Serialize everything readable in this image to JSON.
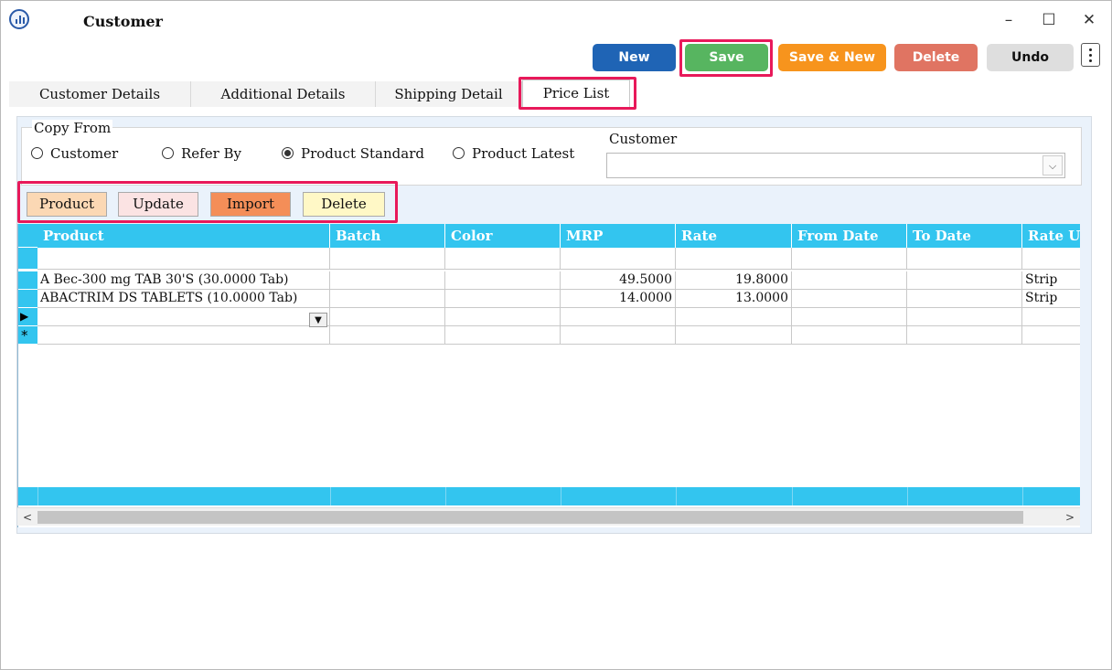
{
  "window": {
    "title": "Customer",
    "controls": {
      "minimize": "–",
      "maximize": "☐",
      "close": "✕"
    }
  },
  "toolbar": {
    "new_label": "New",
    "save_label": "Save",
    "save_new_label": "Save & New",
    "delete_label": "Delete",
    "undo_label": "Undo",
    "colors": {
      "new": "#1f64b5",
      "save": "#57b560",
      "save_new": "#f7941d",
      "delete": "#e07462",
      "undo": "#dedede"
    }
  },
  "tabs": [
    {
      "label": "Customer Details"
    },
    {
      "label": "Additional Details"
    },
    {
      "label": "Shipping Detail"
    },
    {
      "label": "Price List",
      "active": true
    }
  ],
  "copy_from": {
    "legend": "Copy From",
    "options": [
      {
        "label": "Customer",
        "checked": false
      },
      {
        "label": "Refer By",
        "checked": false
      },
      {
        "label": "Product Standard",
        "checked": true
      },
      {
        "label": "Product Latest",
        "checked": false
      }
    ],
    "customer_label": "Customer",
    "customer_value": ""
  },
  "actions": {
    "product_label": "Product",
    "update_label": "Update",
    "import_label": "Import",
    "delete_label": "Delete"
  },
  "grid": {
    "columns": [
      "Product",
      "Batch",
      "Color",
      "MRP",
      "Rate",
      "From Date",
      "To Date",
      "Rate Un"
    ],
    "rows": [
      [
        "",
        "",
        "",
        "",
        "",
        "",
        "",
        ""
      ],
      [
        "A Bec-300 mg TAB 30'S (30.0000  Tab)",
        "",
        "",
        "49.5000",
        "19.8000",
        "",
        "",
        "Strip"
      ],
      [
        "ABACTRIM DS TABLETS (10.0000  Tab)",
        "",
        "",
        "14.0000",
        "13.0000",
        "",
        "",
        "Strip"
      ],
      [
        "",
        "",
        "",
        "",
        "",
        "",
        "",
        ""
      ],
      [
        "",
        "",
        "",
        "",
        "",
        "",
        "",
        ""
      ]
    ],
    "current_row_marker": "▶",
    "new_row_marker": "*",
    "header_color": "#33c5ef"
  }
}
